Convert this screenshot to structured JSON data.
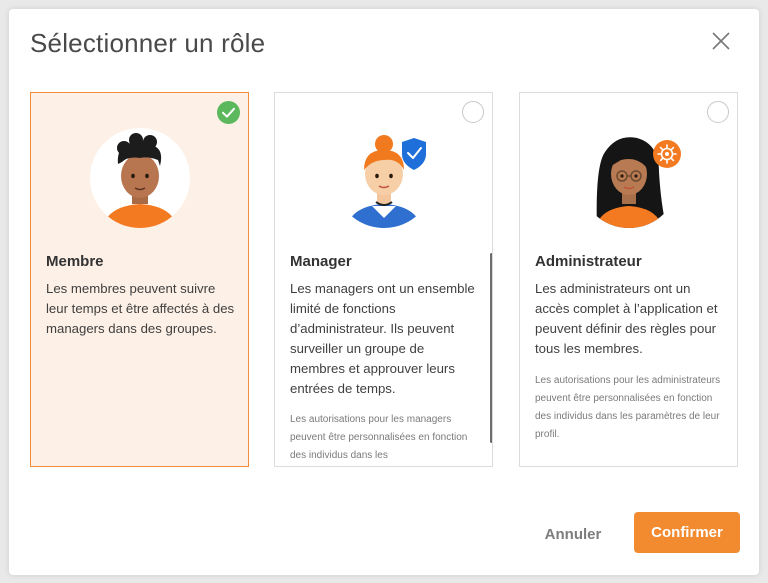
{
  "dialog": {
    "title": "Sélectionner un rôle"
  },
  "roles": [
    {
      "name": "Membre",
      "description": "Les membres peuvent suivre leur temps et être affectés à des managers dans des groupes.",
      "note": "",
      "selected": true,
      "badge_icon": ""
    },
    {
      "name": "Manager",
      "description": "Les managers ont un ensemble limité de fonctions d’administrateur. Ils peuvent surveiller un groupe de membres et approuver leurs entrées de temps.",
      "note": "Les autorisations pour les managers peuvent être personnalisées en fonction des individus dans les",
      "selected": false,
      "badge_icon": "shield-check-icon"
    },
    {
      "name": "Administrateur",
      "description": "Les administrateurs ont un accès complet à l’application et peuvent définir des règles pour tous les membres.",
      "note": "Les autorisations pour les administrateurs peuvent être personnalisées en fonction des individus dans les paramètres de leur profil.",
      "selected": false,
      "badge_icon": "gear-icon"
    }
  ],
  "actions": {
    "cancel_label": "Annuler",
    "confirm_label": "Confirmer"
  },
  "colors": {
    "accent": "#f28a30",
    "selected_bg": "#fdf0e6",
    "check_green": "#5cb85c",
    "shield_blue": "#1e6fd9"
  }
}
